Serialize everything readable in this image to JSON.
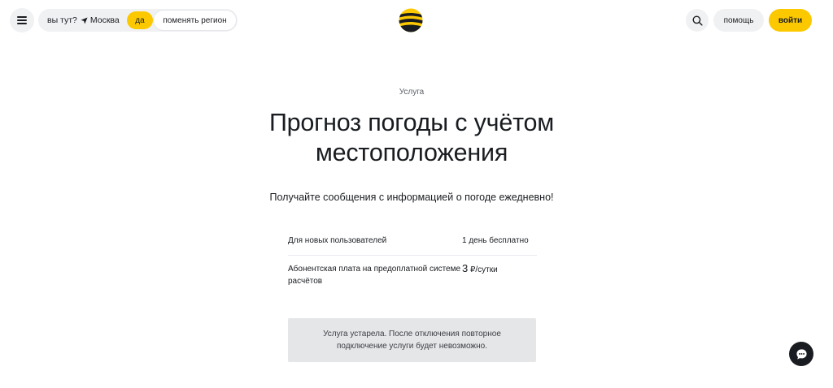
{
  "header": {
    "menu_icon": "hamburger-menu-icon",
    "region": {
      "question": "вы тут?",
      "geo_icon": "location-arrow-icon",
      "city": "Москва",
      "confirm_label": "да",
      "change_label": "поменять регион"
    },
    "logo_icon": "beeline-logo-icon",
    "search_icon": "search-icon",
    "help_label": "помощь",
    "login_label": "войти"
  },
  "main": {
    "eyebrow": "Услуга",
    "title": "Прогноз погоды с учётом местоположения",
    "subtitle": "Получайте сообщения с информацией о погоде ежедневно!",
    "tariffs": [
      {
        "label": "Для новых пользователей",
        "value": "1 день бесплатно"
      },
      {
        "label": "Абонентская плата на предоплатной системе расчётов",
        "price_number": "3",
        "price_unit": "₽/сутки"
      }
    ],
    "notice": "Услуга устарела. После отключения повторное подключение услуги будет невозможно."
  },
  "chat_icon": "chat-bubble-icon",
  "colors": {
    "accent": "#fcc900",
    "pill_bg": "#f0f1f3",
    "notice_bg": "#e5e6e8",
    "text": "#191c20",
    "chat_bg": "#191c20"
  }
}
